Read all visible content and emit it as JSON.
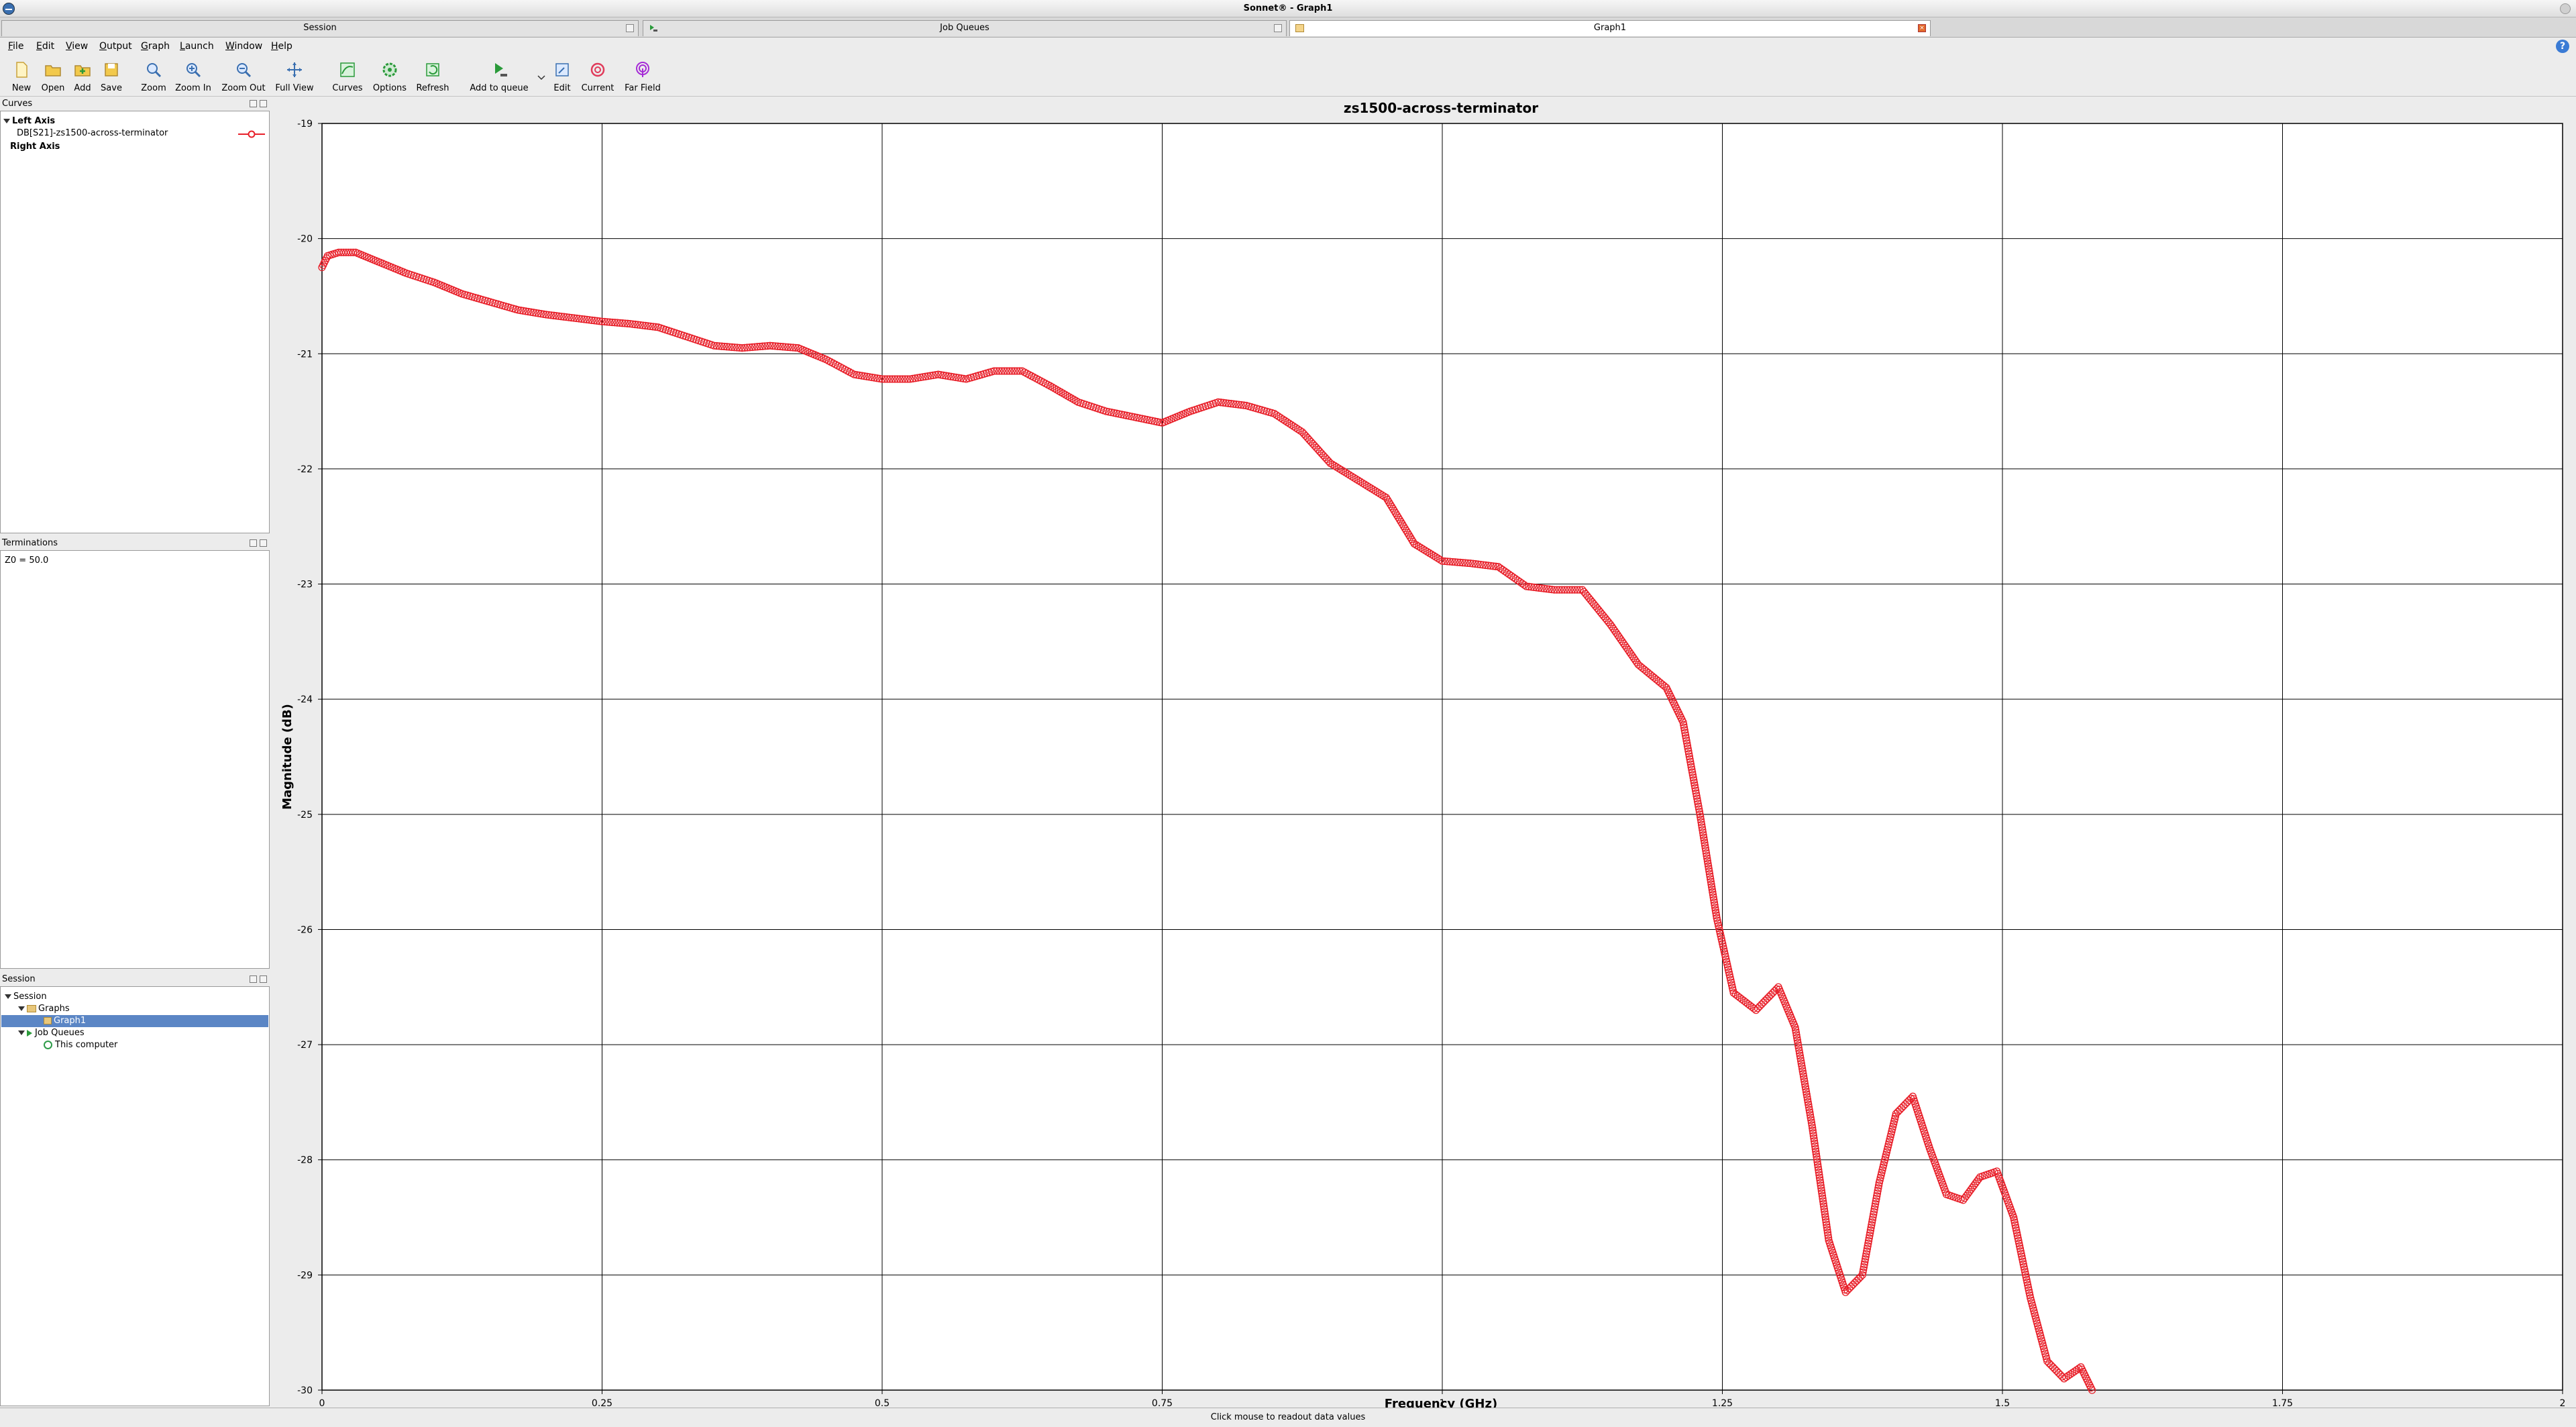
{
  "window": {
    "title": "Sonnet® - Graph1"
  },
  "tabs": [
    {
      "label": "Session"
    },
    {
      "label": "Job Queues"
    },
    {
      "label": "Graph1"
    }
  ],
  "menu": [
    "File",
    "Edit",
    "View",
    "Output",
    "Graph",
    "Launch",
    "Window",
    "Help"
  ],
  "toolbar": [
    {
      "label": "New",
      "icon": "new-file-icon"
    },
    {
      "label": "Open",
      "icon": "open-folder-icon"
    },
    {
      "label": "Add",
      "icon": "add-file-icon"
    },
    {
      "label": "Save",
      "icon": "save-icon"
    },
    {
      "label": "Zoom",
      "icon": "zoom-icon"
    },
    {
      "label": "Zoom In",
      "icon": "zoom-in-icon"
    },
    {
      "label": "Zoom Out",
      "icon": "zoom-out-icon"
    },
    {
      "label": "Full View",
      "icon": "full-view-icon"
    },
    {
      "label": "Curves",
      "icon": "curves-icon"
    },
    {
      "label": "Options",
      "icon": "options-gear-icon"
    },
    {
      "label": "Refresh",
      "icon": "refresh-icon"
    },
    {
      "label": "Add to queue",
      "icon": "add-to-queue-icon"
    },
    {
      "label": "Edit",
      "icon": "edit-icon"
    },
    {
      "label": "Current",
      "icon": "current-icon"
    },
    {
      "label": "Far Field",
      "icon": "far-field-icon"
    }
  ],
  "curves_panel": {
    "title": "Curves",
    "left_axis": "Left Axis",
    "curve_label": "DB[S21]-zs1500-across-terminator",
    "right_axis": "Right Axis",
    "curve_color": "#e8202a"
  },
  "terminations_panel": {
    "title": "Terminations",
    "value": "Z0 = 50.0"
  },
  "session_panel": {
    "title": "Session",
    "root": "Session",
    "graphs": "Graphs",
    "graph1": "Graph1",
    "job_queues": "Job Queues",
    "this_computer": "This computer"
  },
  "status": {
    "text": "Click mouse to readout data values"
  },
  "chart_data": {
    "type": "scatter",
    "title": "zs1500-across-terminator",
    "xlabel": "Frequency (GHz)",
    "ylabel": "Magnitude (dB)",
    "xlim": [
      0,
      2
    ],
    "ylim": [
      -30,
      -19
    ],
    "x_ticks": [
      "0",
      "0.25",
      "0.5",
      "0.75",
      "1",
      "1.25",
      "1.5",
      "1.75",
      "2"
    ],
    "y_ticks": [
      "-19",
      "-20",
      "-21",
      "-22",
      "-23",
      "-24",
      "-25",
      "-26",
      "-27",
      "-28",
      "-29",
      "-30"
    ],
    "grid": true,
    "marker": "open-circle",
    "series": [
      {
        "name": "DB[S21]-zs1500-across-terminator",
        "color": "#e8202a",
        "x": [
          0,
          0.005,
          0.015,
          0.03,
          0.05,
          0.075,
          0.1,
          0.125,
          0.15,
          0.175,
          0.2,
          0.225,
          0.25,
          0.275,
          0.3,
          0.325,
          0.35,
          0.375,
          0.4,
          0.425,
          0.45,
          0.475,
          0.5,
          0.525,
          0.55,
          0.575,
          0.6,
          0.625,
          0.65,
          0.675,
          0.7,
          0.725,
          0.75,
          0.775,
          0.8,
          0.825,
          0.85,
          0.875,
          0.9,
          0.925,
          0.95,
          0.975,
          1.0,
          1.025,
          1.05,
          1.075,
          1.1,
          1.125,
          1.15,
          1.175,
          1.2,
          1.215,
          1.23,
          1.245,
          1.26,
          1.28,
          1.3,
          1.315,
          1.33,
          1.345,
          1.36,
          1.375,
          1.39,
          1.405,
          1.42,
          1.435,
          1.45,
          1.465,
          1.48,
          1.495,
          1.51,
          1.525,
          1.54,
          1.555,
          1.57,
          1.58
        ],
        "y": [
          -20.25,
          -20.15,
          -20.12,
          -20.12,
          -20.2,
          -20.3,
          -20.38,
          -20.48,
          -20.55,
          -20.62,
          -20.66,
          -20.69,
          -20.72,
          -20.74,
          -20.77,
          -20.85,
          -20.93,
          -20.95,
          -20.93,
          -20.95,
          -21.05,
          -21.18,
          -21.22,
          -21.22,
          -21.18,
          -21.22,
          -21.15,
          -21.15,
          -21.28,
          -21.42,
          -21.5,
          -21.55,
          -21.6,
          -21.5,
          -21.42,
          -21.45,
          -21.52,
          -21.68,
          -21.95,
          -22.1,
          -22.25,
          -22.65,
          -22.8,
          -22.82,
          -22.85,
          -23.02,
          -23.05,
          -23.05,
          -23.35,
          -23.7,
          -23.9,
          -24.2,
          -25.0,
          -25.9,
          -26.55,
          -26.7,
          -26.5,
          -26.85,
          -27.7,
          -28.7,
          -29.15,
          -29.0,
          -28.2,
          -27.6,
          -27.45,
          -27.9,
          -28.3,
          -28.35,
          -28.15,
          -28.1,
          -28.5,
          -29.2,
          -29.75,
          -29.9,
          -29.8,
          -30.0
        ]
      }
    ]
  }
}
